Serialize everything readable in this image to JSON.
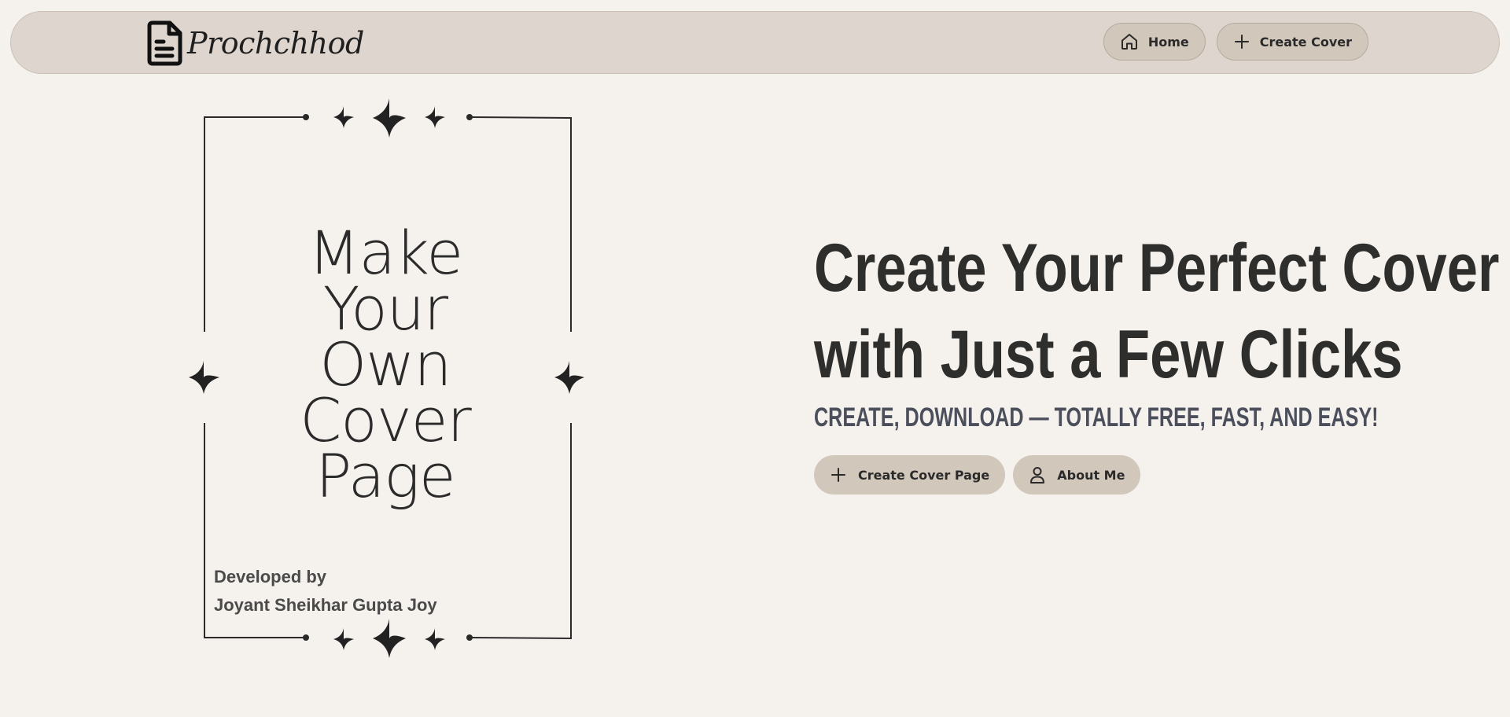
{
  "nav": {
    "brand": "Prochchhod",
    "home_label": "Home",
    "create_label": "Create Cover"
  },
  "cover": {
    "title_lines": [
      "Make",
      "Your",
      "Own",
      "Cover",
      "Page"
    ],
    "developed_by": "Developed by",
    "developer_name": "Joyant Sheikhar Gupta Joy"
  },
  "hero": {
    "heading_line1": "Create Your Perfect Cover",
    "heading_line2": "with Just a Few Clicks",
    "subheading": "CREATE, DOWNLOAD — TOTALLY FREE, FAST, AND EASY!",
    "primary_button": "Create Cover Page",
    "secondary_button": "About Me"
  },
  "icons": {
    "brand": "document-icon",
    "home": "home-icon",
    "create": "plus-icon",
    "about": "user-icon",
    "decor": "sparkle-icon"
  },
  "colors": {
    "background": "#f5f1ed",
    "navbar": "#ded6ce",
    "button": "#d2c7bb",
    "heading": "#2e2e2d",
    "subheading": "#4b4f5c"
  }
}
